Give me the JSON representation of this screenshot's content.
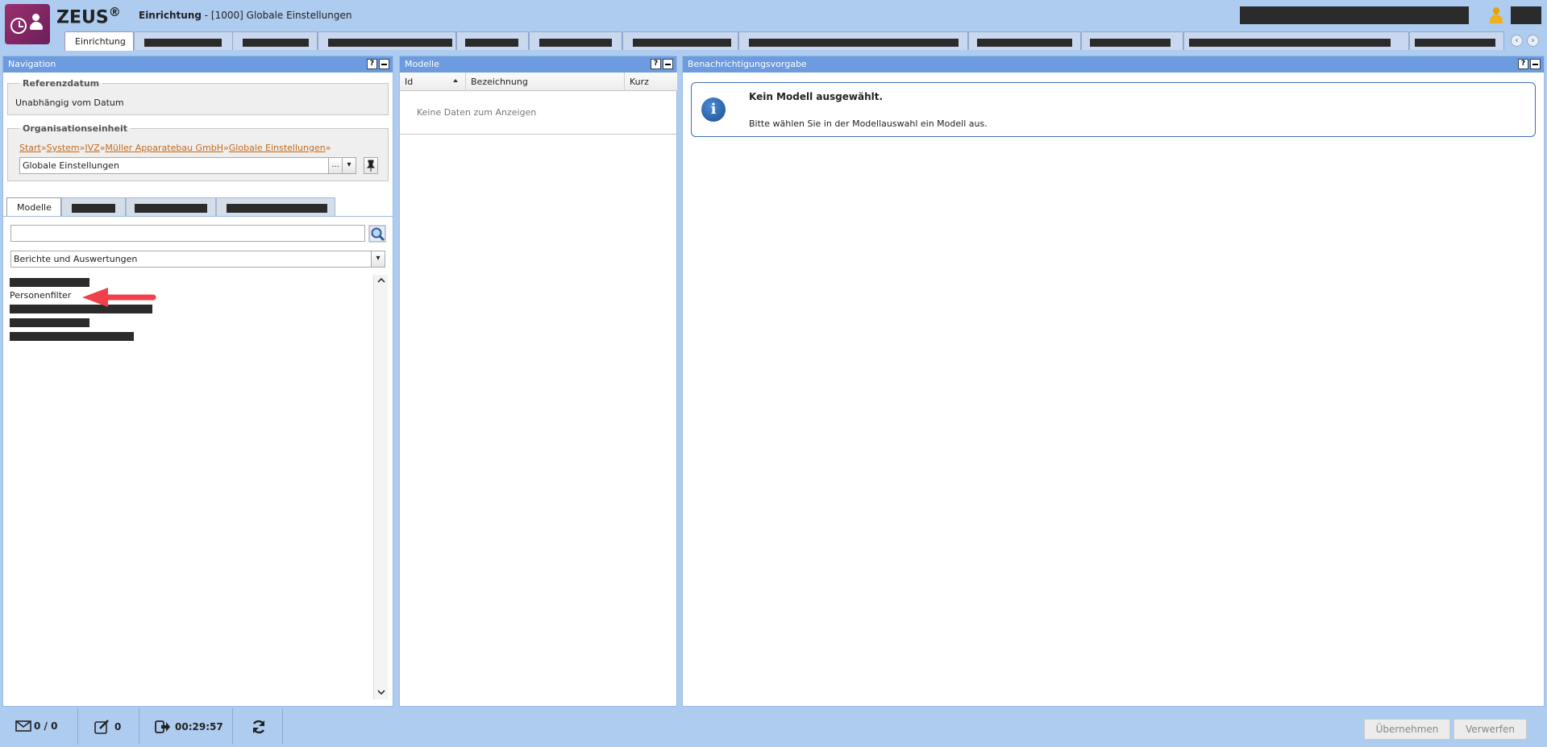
{
  "app": {
    "brand": "ZEUS",
    "brand_mark": "®"
  },
  "title": {
    "section": "Einrichtung",
    "separator": " - ",
    "context": "[1000] Globale Einstellungen"
  },
  "top_tabs": [
    {
      "label": "Einrichtung",
      "active": true
    }
  ],
  "nav_panel": {
    "title": "Navigation",
    "help": "?",
    "referenzdatum": {
      "legend": "Referenzdatum",
      "value": "Unabhängig vom Datum"
    },
    "org": {
      "legend": "Organisationseinheit",
      "breadcrumb": [
        "Start",
        "System",
        "IVZ",
        "Müller Apparatebau GmbH",
        "Globale Einstellungen"
      ],
      "crumb_sep": "»",
      "value": "Globale Einstellungen",
      "more_button": "..."
    },
    "tabs": [
      {
        "label": "Modelle",
        "active": true
      }
    ],
    "search_value": "",
    "category": "Berichte und Auswertungen",
    "items": [
      {
        "label": "Personenfilter"
      }
    ]
  },
  "models_panel": {
    "title": "Modelle",
    "help": "?",
    "columns": [
      "Id",
      "Bezeichnung",
      "Kurz"
    ],
    "empty_text": "Keine Daten zum Anzeigen"
  },
  "notify_panel": {
    "title": "Benachrichtigungsvorgabe",
    "help": "?",
    "info_title": "Kein Modell ausgewählt.",
    "info_text": "Bitte wählen Sie in der Modellauswahl ein Modell aus."
  },
  "footer": {
    "messages": "0 / 0",
    "edits": "0",
    "session_time": "00:29:57",
    "apply_button": "Übernehmen",
    "discard_button": "Verwerfen"
  },
  "colors": {
    "header_bg": "#aecbf0",
    "panel_head": "#6c9be0",
    "link": "#c66a1a",
    "arrow": "#f0404a"
  }
}
